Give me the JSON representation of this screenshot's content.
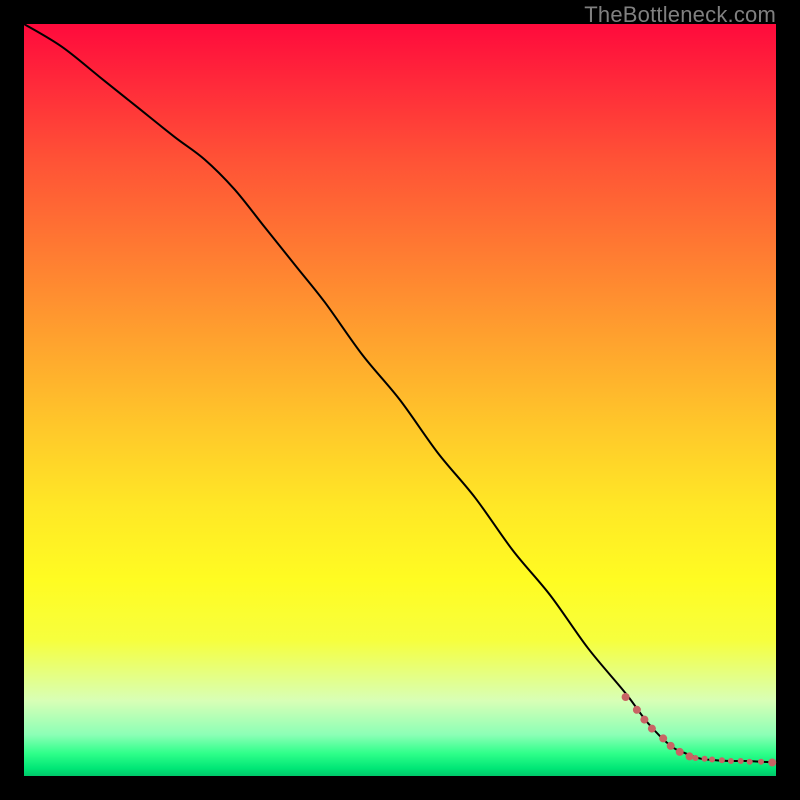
{
  "watermark": "TheBottleneck.com",
  "chart_data": {
    "type": "line",
    "title": "",
    "xlabel": "",
    "ylabel": "",
    "xlim": [
      0,
      100
    ],
    "ylim": [
      0,
      100
    ],
    "grid": false,
    "series": [
      {
        "name": "curve",
        "color": "#000000",
        "x": [
          0,
          5,
          10,
          15,
          20,
          24,
          28,
          32,
          36,
          40,
          45,
          50,
          55,
          60,
          65,
          70,
          75,
          80,
          83,
          86,
          88,
          90,
          92,
          94,
          96,
          98,
          100
        ],
        "y": [
          100,
          97,
          93,
          89,
          85,
          82,
          78,
          73,
          68,
          63,
          56,
          50,
          43,
          37,
          30,
          24,
          17,
          11,
          7,
          4,
          3,
          2.3,
          2.1,
          2.0,
          2.0,
          1.9,
          1.8
        ]
      }
    ],
    "scatter": {
      "name": "end-dots",
      "color": "#c86464",
      "points": [
        {
          "x": 80.0,
          "y": 10.5,
          "r": 4
        },
        {
          "x": 81.5,
          "y": 8.8,
          "r": 4
        },
        {
          "x": 82.5,
          "y": 7.5,
          "r": 4
        },
        {
          "x": 83.5,
          "y": 6.3,
          "r": 4
        },
        {
          "x": 85.0,
          "y": 5.0,
          "r": 4
        },
        {
          "x": 86.0,
          "y": 4.0,
          "r": 4
        },
        {
          "x": 87.2,
          "y": 3.2,
          "r": 4
        },
        {
          "x": 88.5,
          "y": 2.6,
          "r": 4
        },
        {
          "x": 89.3,
          "y": 2.4,
          "r": 3
        },
        {
          "x": 90.5,
          "y": 2.3,
          "r": 3
        },
        {
          "x": 91.5,
          "y": 2.2,
          "r": 3
        },
        {
          "x": 92.8,
          "y": 2.1,
          "r": 3
        },
        {
          "x": 94.0,
          "y": 2.0,
          "r": 3
        },
        {
          "x": 95.3,
          "y": 2.0,
          "r": 3
        },
        {
          "x": 96.5,
          "y": 1.9,
          "r": 3
        },
        {
          "x": 98.0,
          "y": 1.9,
          "r": 3
        },
        {
          "x": 99.5,
          "y": 1.8,
          "r": 4
        }
      ]
    },
    "background_gradient_stops": [
      {
        "pos": 0.0,
        "color": "#ff0a3c"
      },
      {
        "pos": 0.08,
        "color": "#ff2a3a"
      },
      {
        "pos": 0.18,
        "color": "#ff5236"
      },
      {
        "pos": 0.3,
        "color": "#ff7a32"
      },
      {
        "pos": 0.42,
        "color": "#ffa22e"
      },
      {
        "pos": 0.54,
        "color": "#ffc92a"
      },
      {
        "pos": 0.64,
        "color": "#ffe726"
      },
      {
        "pos": 0.74,
        "color": "#fffc22"
      },
      {
        "pos": 0.82,
        "color": "#f6ff3e"
      },
      {
        "pos": 0.9,
        "color": "#d8ffb6"
      },
      {
        "pos": 0.945,
        "color": "#8cffb6"
      },
      {
        "pos": 0.97,
        "color": "#2fff8a"
      },
      {
        "pos": 0.99,
        "color": "#00e676"
      },
      {
        "pos": 1.0,
        "color": "#00c86a"
      }
    ]
  }
}
